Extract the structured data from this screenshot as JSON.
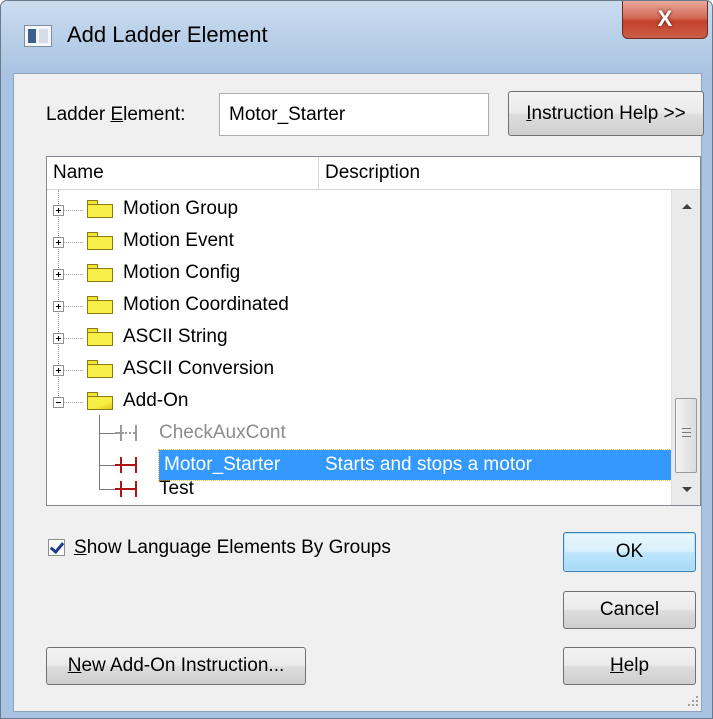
{
  "window": {
    "title": "Add Ladder Element",
    "close_glyph": "X"
  },
  "element_field": {
    "label_prefix": "Ladder ",
    "label_accel": "E",
    "label_suffix": "lement:",
    "value": "Motor_Starter"
  },
  "buttons": {
    "instruction_help_accel": "I",
    "instruction_help_rest": "nstruction Help >>",
    "ok": "OK",
    "cancel": "Cancel",
    "help_accel": "H",
    "help_rest": "elp",
    "new_aoi_accel": "N",
    "new_aoi_rest": "ew Add-On Instruction..."
  },
  "tree": {
    "columns": [
      "Name",
      "Description"
    ],
    "groups": [
      {
        "label": "Motion Group",
        "expanded": false
      },
      {
        "label": "Motion Event",
        "expanded": false
      },
      {
        "label": "Motion Config",
        "expanded": false
      },
      {
        "label": "Motion Coordinated",
        "expanded": false
      },
      {
        "label": "ASCII String",
        "expanded": false
      },
      {
        "label": "ASCII Conversion",
        "expanded": false
      },
      {
        "label": "Add-On",
        "expanded": true
      }
    ],
    "children": [
      {
        "label": "CheckAuxCont",
        "description": "",
        "state": "disabled"
      },
      {
        "label": "Motor_Starter",
        "description": "Starts and stops a motor",
        "state": "selected"
      },
      {
        "label": "Test",
        "description": "",
        "state": "normal"
      }
    ]
  },
  "show_groups": {
    "checked": true,
    "label_accel": "S",
    "label_rest": "how Language Elements By Groups"
  },
  "colors": {
    "selection": "#3399ff",
    "icon_red": "#b01515",
    "folder": "#f7ee46"
  }
}
